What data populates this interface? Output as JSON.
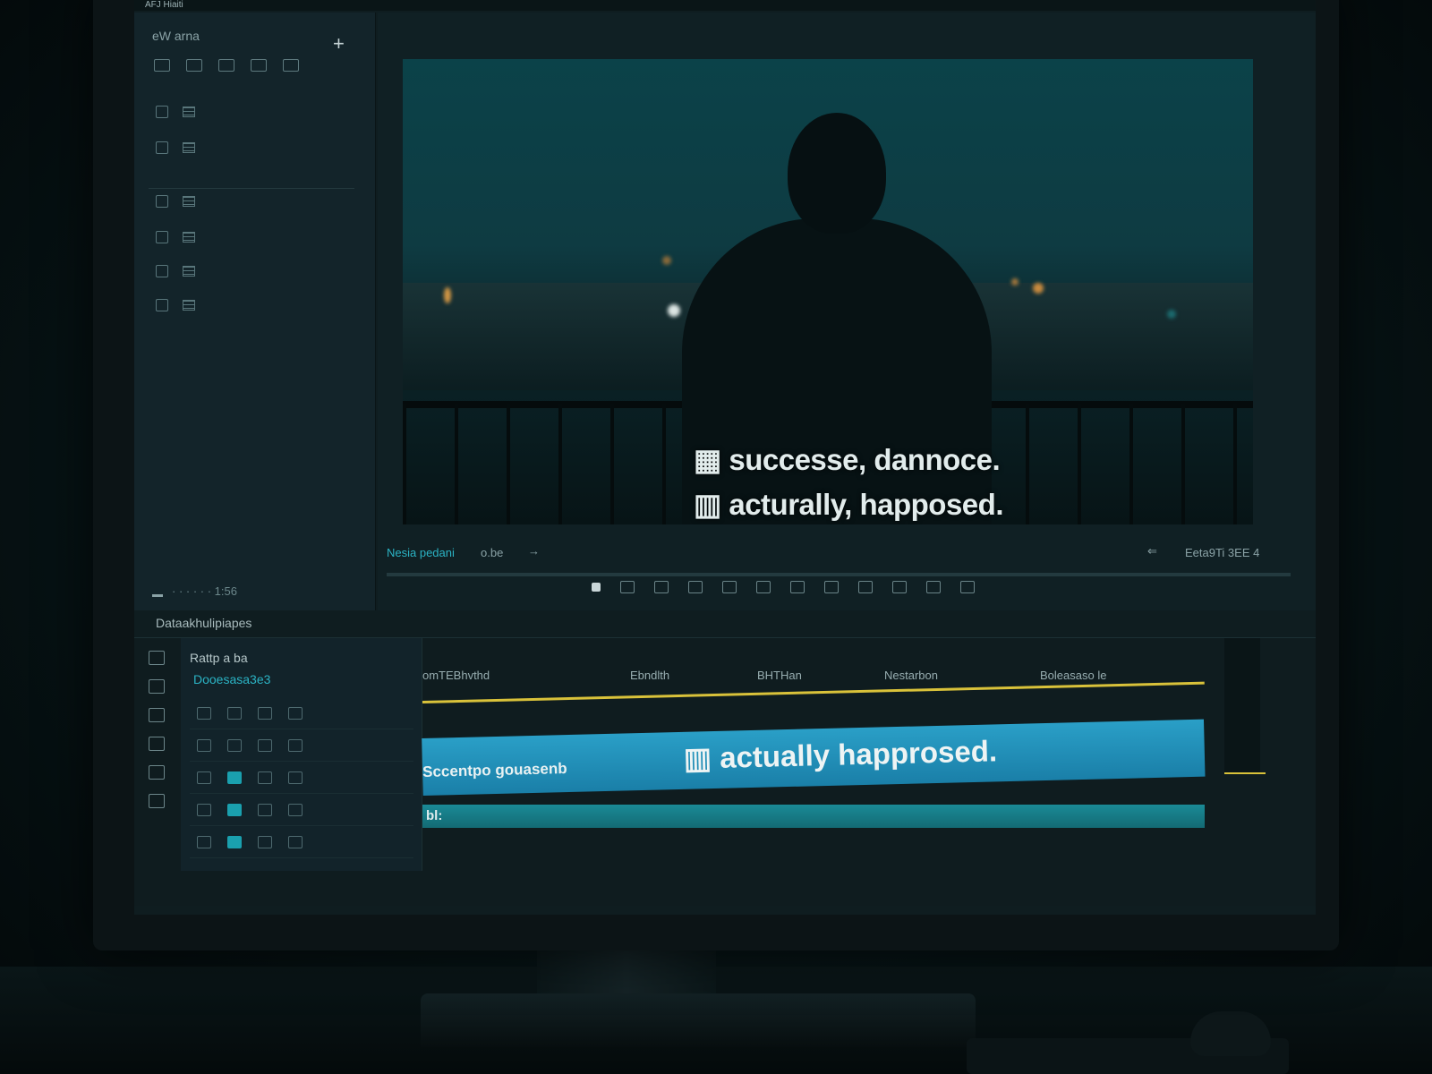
{
  "window": {
    "title": "AFJ Hiaiti"
  },
  "media_panel": {
    "title": "eW arna",
    "add_label": "+",
    "footer_text": "· · · · · · 1:56"
  },
  "viewer": {
    "subtitle_line1": "▦ successe, dannoce.",
    "subtitle_line2": "▥ acturally, happosed.",
    "timecode": "Nesia pedani",
    "fps": "o.be",
    "arrow": "→",
    "back": "⇐",
    "duration": "Eeta9Ti 3EE 4"
  },
  "timeline": {
    "label": "Dataakhulipiapes",
    "track_title": "Rattp a ba",
    "track_subtitle": "Dooesasa3e3",
    "columns": [
      "omTEBhvthd",
      "Ebndlth",
      "BHTHan",
      "Nestarbon",
      "Boleasaso le"
    ],
    "clip_name": "Sccentpo gouasenb",
    "clip_text": "▥ actually happrosed.",
    "audio_label": "bl:"
  }
}
